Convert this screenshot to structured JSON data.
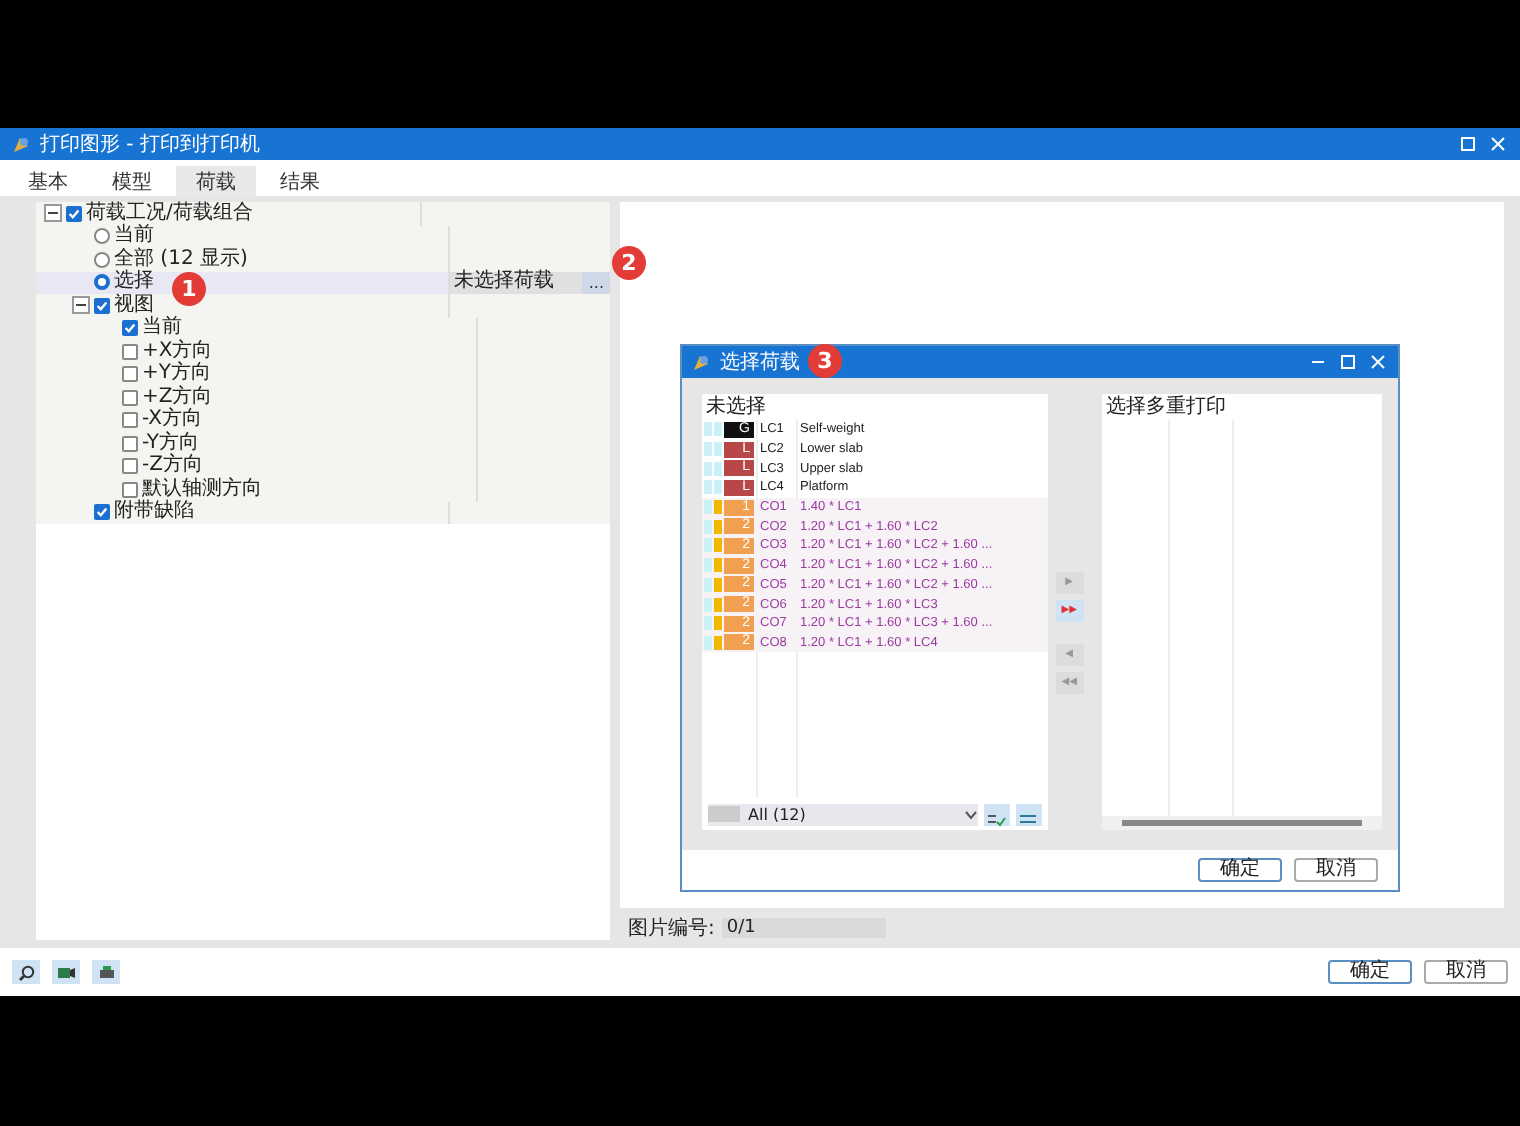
{
  "window": {
    "title": "打印图形 - 打印到打印机"
  },
  "tabs": [
    {
      "label": "基本",
      "selected": false
    },
    {
      "label": "模型",
      "selected": false
    },
    {
      "label": "荷载",
      "selected": true
    },
    {
      "label": "结果",
      "selected": false
    }
  ],
  "tree": [
    {
      "kind": "checkbox",
      "label": "荷载工况/荷载组合",
      "checked": true,
      "expanded": true,
      "children": [
        {
          "kind": "radio",
          "label": "当前",
          "selected": false
        },
        {
          "kind": "radio",
          "label": "全部 (12 显示)",
          "selected": false
        },
        {
          "kind": "radio",
          "label": "选择",
          "selected": true,
          "value": "未选择荷载",
          "browse": "..."
        },
        {
          "kind": "checkbox",
          "label": "视图",
          "checked": true,
          "expanded": true,
          "children": [
            {
              "kind": "checkbox",
              "label": "当前",
              "checked": true
            },
            {
              "kind": "checkbox",
              "label": "+X方向",
              "checked": false
            },
            {
              "kind": "checkbox",
              "label": "+Y方向",
              "checked": false
            },
            {
              "kind": "checkbox",
              "label": "+Z方向",
              "checked": false
            },
            {
              "kind": "checkbox",
              "label": "-X方向",
              "checked": false
            },
            {
              "kind": "checkbox",
              "label": "-Y方向",
              "checked": false
            },
            {
              "kind": "checkbox",
              "label": "-Z方向",
              "checked": false
            },
            {
              "kind": "checkbox",
              "label": "默认轴测方向",
              "checked": false
            }
          ]
        },
        {
          "kind": "checkbox",
          "label": "附带缺陷",
          "checked": true
        }
      ]
    }
  ],
  "preview": {
    "label": "图片编号:",
    "value": "0/1"
  },
  "toolbar": {
    "buttons": [
      "确定",
      "取消"
    ]
  },
  "dialog": {
    "title": "选择荷载",
    "left_list": {
      "header": "未选择",
      "rows": [
        {
          "kind": "case",
          "tag": "G",
          "color": "#111111",
          "name": "LC1",
          "description": "Self-weight"
        },
        {
          "kind": "case",
          "tag": "L",
          "color": "#b84848",
          "name": "LC2",
          "description": "Lower slab"
        },
        {
          "kind": "case",
          "tag": "L",
          "color": "#b84848",
          "name": "LC3",
          "description": "Upper slab"
        },
        {
          "kind": "case",
          "tag": "L",
          "color": "#b84848",
          "name": "LC4",
          "description": "Platform"
        },
        {
          "kind": "combo",
          "tag": "1",
          "color": "#f0a050",
          "name": "CO1",
          "description": "1.40 * LC1"
        },
        {
          "kind": "combo",
          "tag": "2",
          "color": "#f0a050",
          "name": "CO2",
          "description": "1.20 * LC1 + 1.60 * LC2"
        },
        {
          "kind": "combo",
          "tag": "2",
          "color": "#f0a050",
          "name": "CO3",
          "description": "1.20 * LC1 + 1.60 * LC2 + 1.60 ..."
        },
        {
          "kind": "combo",
          "tag": "2",
          "color": "#f0a050",
          "name": "CO4",
          "description": "1.20 * LC1 + 1.60 * LC2 + 1.60 ..."
        },
        {
          "kind": "combo",
          "tag": "2",
          "color": "#f0a050",
          "name": "CO5",
          "description": "1.20 * LC1 + 1.60 * LC2 + 1.60 ..."
        },
        {
          "kind": "combo",
          "tag": "2",
          "color": "#f0a050",
          "name": "CO6",
          "description": "1.20 * LC1 + 1.60 * LC3"
        },
        {
          "kind": "combo",
          "tag": "2",
          "color": "#f0a050",
          "name": "CO7",
          "description": "1.20 * LC1 + 1.60 * LC3 + 1.60 ..."
        },
        {
          "kind": "combo",
          "tag": "2",
          "color": "#f0a050",
          "name": "CO8",
          "description": "1.20 * LC1 + 1.60 * LC4"
        }
      ],
      "filter": "All (12)"
    },
    "transfer": [
      {
        "glyph": "▶",
        "active": false
      },
      {
        "glyph": "▶▶",
        "active": true
      },
      {
        "glyph": "◀",
        "active": false
      },
      {
        "glyph": "◀◀",
        "active": false
      }
    ],
    "right_list": {
      "header": "选择多重打印"
    },
    "buttons": [
      "确定",
      "取消"
    ]
  },
  "callouts": [
    "1",
    "2",
    "3"
  ]
}
